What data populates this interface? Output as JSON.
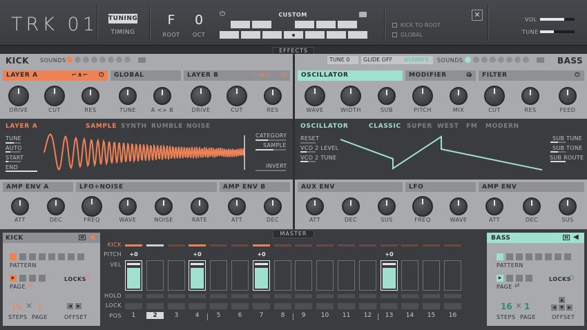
{
  "header": {
    "logo": "TRK 01",
    "tuning_label": "TUNING",
    "timing_label": "TIMING",
    "root_note": "F",
    "root_label": "ROOT",
    "octave_value": "0",
    "octave_label": "OCT",
    "scale_name": "CUSTOM",
    "kick_to_root_label": "KICK TO ROOT",
    "global_label": "GLOBAL",
    "close_symbol": "✕",
    "vol_label": "VOL",
    "vol_level": 0.7,
    "tune_label": "TUNE",
    "tune_level": 0.4
  },
  "effects_tab": "EFFECTS",
  "master_tab": "MASTER",
  "kick": {
    "title": "KICK",
    "sounds_label": "SOUNDS",
    "layer_a": "LAYER A",
    "global": "GLOBAL",
    "layer_b": "LAYER B",
    "knobs_a": [
      "DRIVE",
      "CUT",
      "RES"
    ],
    "knobs_global": [
      "TUNE",
      "A <> B"
    ],
    "knobs_b": [
      "DRIVE",
      "CUT",
      "RES"
    ],
    "editor_title": "LAYER A",
    "modes": [
      "SAMPLE",
      "SYNTH",
      "RUMBLE",
      "NOISE"
    ],
    "left_params": [
      "TUNE",
      "AUTO",
      "START",
      "END"
    ],
    "right_params": [
      "CATEGORY",
      "SAMPLE",
      "INVERT"
    ],
    "env_headers": [
      "AMP ENV A",
      "LFO+NOISE",
      "AMP ENV B"
    ],
    "env_knobs": [
      "ATT",
      "DEC",
      "FREQ",
      "WAVE",
      "NOISE",
      "RATE",
      "ATT",
      "DEC"
    ]
  },
  "bass": {
    "title": "BASS",
    "tune_label": "TUNE",
    "tune_value": "0",
    "glide_label": "GLIDE",
    "glide_value": "OFF",
    "always_label": "ALWAYS",
    "sounds_label": "SOUNDS",
    "oscillator": "OSCILLATOR",
    "modifier": "MODIFIER",
    "filter": "FILTER",
    "knobs_osc": [
      "WAVE",
      "WIDTH",
      "SUB"
    ],
    "knobs_mod": [
      "PITCH",
      "MIX"
    ],
    "knobs_filter": [
      "CUT",
      "RES",
      "FEED"
    ],
    "editor_title": "OSCILLATOR",
    "modes": [
      "CLASSIC",
      "SUPER",
      "WEST",
      "FM",
      "MODERN"
    ],
    "left_params": [
      "RESET",
      "VCO 2 LEVEL",
      "VCO 2 TUNE"
    ],
    "right_params": [
      "SUB TUNE",
      "SUB TONE",
      "SUB ROUTE"
    ],
    "env_headers": [
      "AUX ENV",
      "LFO",
      "AMP ENV"
    ],
    "env_knobs": [
      "ATT",
      "DEC",
      "SUS",
      "FREQ",
      "WAVE",
      "ATT",
      "DEC",
      "SUS"
    ]
  },
  "seq": {
    "kick_side": {
      "title": "KICK",
      "pattern": "PATTERN",
      "page": "PAGE",
      "locks": "LOCKS",
      "steps_value": "16",
      "steps_label": "STEPS",
      "page_value": "1",
      "page_label": "PAGE",
      "offset": "OFFSET"
    },
    "bass_side": {
      "title": "BASS",
      "pattern": "PATTERN",
      "page": "PAGE",
      "locks": "LOCKS",
      "steps_value": "16",
      "steps_label": "STEPS",
      "page_value": "1",
      "page_label": "PAGE",
      "offset": "OFFSET"
    },
    "row_labels": [
      "KICK",
      "PITCH",
      "VEL",
      "HOLD",
      "LOCK",
      "POS"
    ],
    "positions": [
      "1",
      "2",
      "3",
      "4",
      "5",
      "6",
      "7",
      "8",
      "9",
      "10",
      "11",
      "12",
      "13",
      "14",
      "15",
      "16"
    ],
    "selected_pos": 1,
    "kick_steps": [
      1,
      2,
      0,
      1,
      0,
      0,
      1,
      0,
      0,
      0,
      0,
      0,
      0,
      0,
      0,
      0
    ],
    "active_steps": [
      0,
      3,
      6,
      12
    ],
    "pitch_values": [
      "+0",
      "",
      "",
      "+0",
      "",
      "",
      "+0",
      "",
      "",
      "",
      "",
      "",
      "+0",
      "",
      "",
      ""
    ]
  },
  "colors": {
    "orange": "#ee8256",
    "teal": "#9fe0cf"
  }
}
